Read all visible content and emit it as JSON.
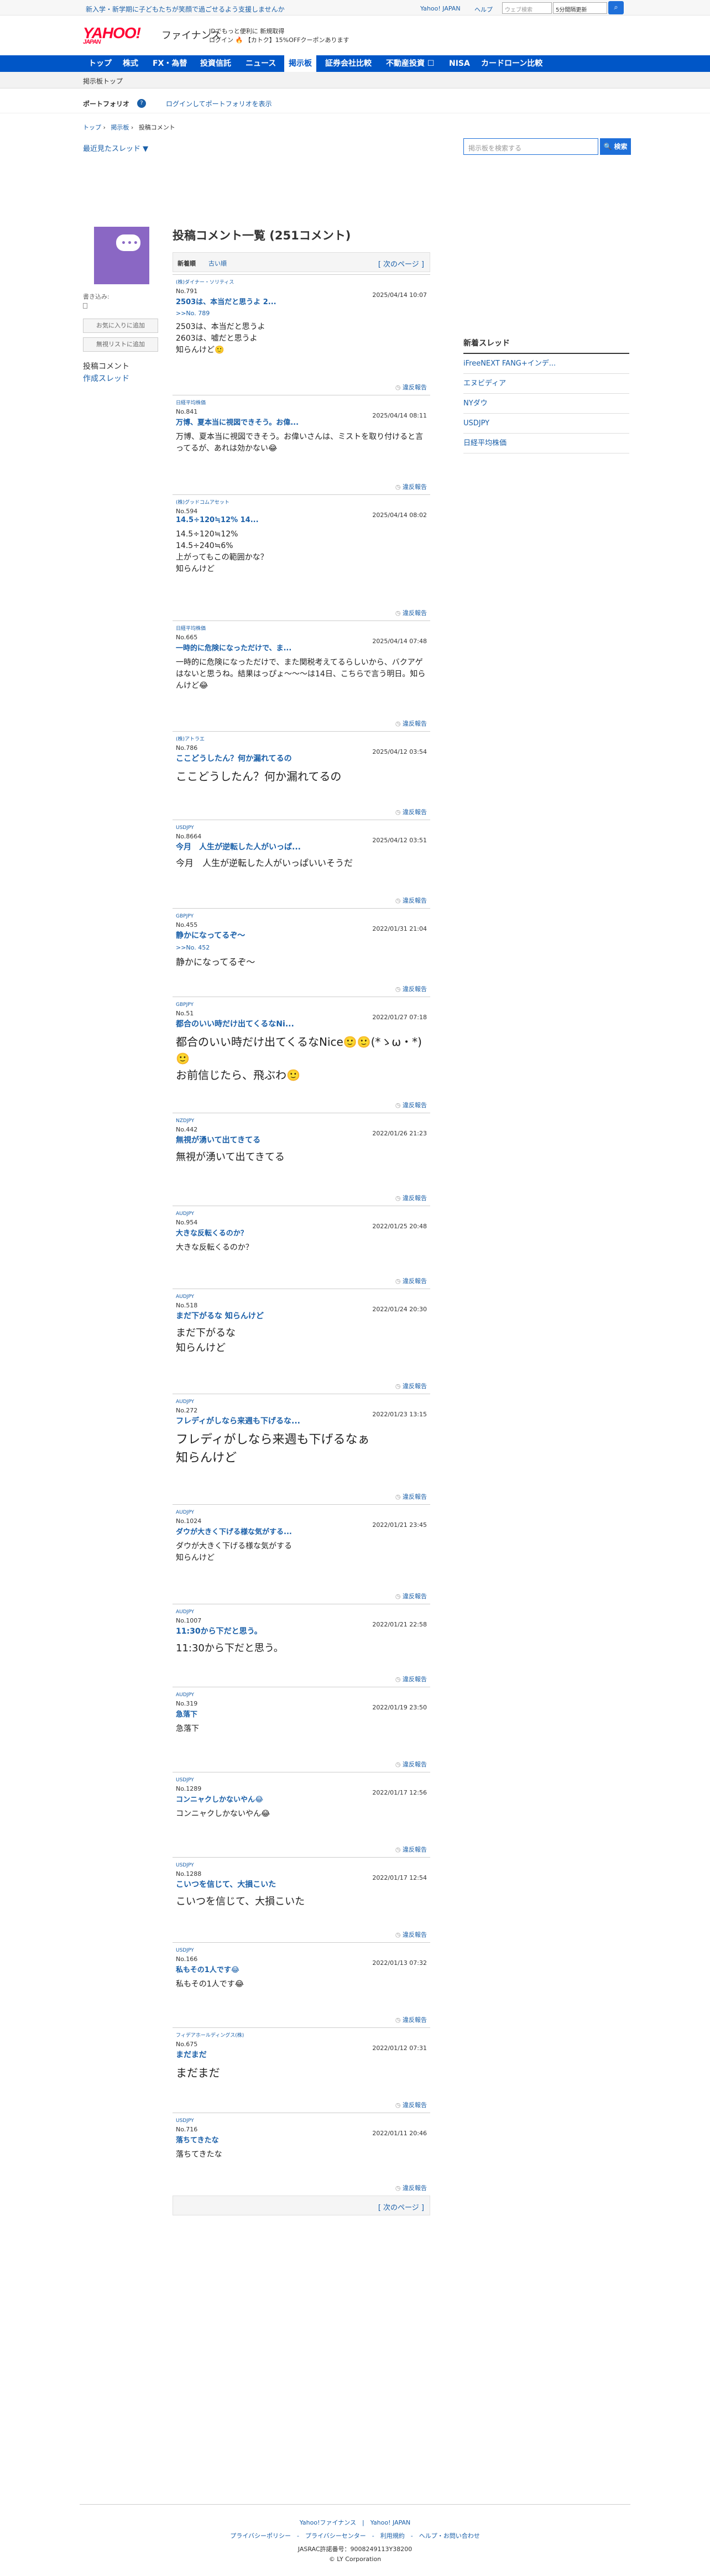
{
  "topbar": {
    "promo": "新入学・新学期に子どもたちが笑顔で過ごせるよう支援しませんか",
    "yahoo_japan": "Yahoo! JAPAN",
    "help": "ヘルプ",
    "web_search_placeholder": "ウェブ検索",
    "select_label": "5分間隔更新"
  },
  "brand": {
    "logo": "YAHOO!",
    "logo_sub": "JAPAN",
    "service": "ファイナンス",
    "line1": "IDでもっと便利に 新規取得",
    "line2": "ログイン 🔥 【カトク】15%OFFクーポンあります"
  },
  "nav": [
    "トップ",
    "株式",
    "FX・為替",
    "投資信託",
    "ニュース",
    "掲示板",
    "証券会社比較",
    "不動産投資 ☐",
    "NISA",
    "カードローン比較"
  ],
  "nav_active": "掲示板",
  "sub_nav": {
    "board_top": "掲示板トップ"
  },
  "portfolio": {
    "label": "ポートフォリオ",
    "help": "?",
    "login": "ログインしてポートフォリオを表示"
  },
  "breadcrumb": [
    "トップ",
    "掲示板",
    "投稿コメント"
  ],
  "recent_threads": "最近見たスレッド ▼",
  "board_search": {
    "placeholder": "掲示板を検索する",
    "button": "🔍 検索"
  },
  "sidebar": {
    "owner_label": "書き込み:",
    "favorite_button": "お気に入りに追加",
    "ignore_button": "無視リストに追加",
    "menu_posts": "投稿コメント",
    "menu_threads": "作成スレッド"
  },
  "main": {
    "title": "投稿コメント一覧 (251コメント)",
    "tab_new": "新着順",
    "tab_old": "古い順",
    "next": "[ 次のページ ]",
    "report_label": "違反報告"
  },
  "posts": [
    {
      "stock": "(株)ダイナー・ソリティス",
      "no": "No.791",
      "date": "2025/04/14 10:07",
      "title": "2503は、本当だと思うよ 2...",
      "reply": ">>No. 789",
      "body": "2503は、本当だと思うよ\n2603は、嘘だと思うよ\n知らんけど🙂",
      "size": "14px"
    },
    {
      "stock": "日経平均株価",
      "no": "No.841",
      "date": "2025/04/14 08:11",
      "title": "万博、夏本当に視図できそう。お偉...",
      "reply": "",
      "body": "万博、夏本当に視図できそう。お偉いさんは、ミストを取り付けると言ってるが、あれは効かない😂",
      "size": "14px"
    },
    {
      "stock": "(株)グッドコムアセット",
      "no": "No.594",
      "date": "2025/04/14 08:02",
      "title": "14.5÷120≒12% 14...",
      "reply": "",
      "body": "14.5÷120≒12%\n14.5÷240≒6%\n上がってもこの範囲かな？\n知らんけど",
      "size": "14px"
    },
    {
      "stock": "日経平均株価",
      "no": "No.665",
      "date": "2025/04/14 07:48",
      "title": "一時的に危険になっただけで、ま...",
      "reply": "",
      "body": "一時的に危険になっただけで、また関税考えてるらしいから、バクアゲはないと思うね。結果はっぴょ〜〜〜は14日、こちらで言う明日。知らんけど😂",
      "size": "14px"
    },
    {
      "stock": "(株)アトラエ",
      "no": "No.786",
      "date": "2025/04/12 03:54",
      "title": "ここどうしたん？何か漏れてるの",
      "reply": "",
      "body": "ここどうしたん？何か漏れてるの",
      "size": "20px"
    },
    {
      "stock": "USDJPY",
      "no": "No.8664",
      "date": "2025/04/12 03:51",
      "title": "今月　人生が逆転した人がいっぱ...",
      "reply": "",
      "body": "今月　人生が逆転した人がいっぱいいそうだ",
      "size": "16px"
    },
    {
      "stock": "GBPJPY",
      "no": "No.455",
      "date": "2022/01/31 21:04",
      "title": "静かになってるぞ〜",
      "reply": ">>No. 452",
      "body": "静かになってるぞ〜",
      "size": "16px"
    },
    {
      "stock": "GBPJPY",
      "no": "No.51",
      "date": "2022/01/27 07:18",
      "title": "都合のいい時だけ出てくるなNi...",
      "reply": "",
      "body": "都合のいい時だけ出てくるなNice🙂🙂(*ゝω・*)🙂\nお前信じたら、飛ぶわ🙂",
      "size": "20px"
    },
    {
      "stock": "NZDJPY",
      "no": "No.442",
      "date": "2022/01/26 21:23",
      "title": "無視が湧いて出てきてる",
      "reply": "",
      "body": "無視が湧いて出てきてる",
      "size": "18px"
    },
    {
      "stock": "AUDJPY",
      "no": "No.954",
      "date": "2022/01/25 20:48",
      "title": "大きな反転くるのか？",
      "reply": "",
      "body": "大きな反転くるのか？",
      "size": "14px"
    },
    {
      "stock": "AUDJPY",
      "no": "No.518",
      "date": "2022/01/24 20:30",
      "title": "まだ下がるな 知らんけど",
      "reply": "",
      "body": "まだ下がるな\n知らんけど",
      "size": "18px"
    },
    {
      "stock": "AUDJPY",
      "no": "No.272",
      "date": "2022/01/23 13:15",
      "title": "フレディがしなら来週も下げるな...",
      "reply": "",
      "body": "フレディがしなら来週も下げるなぁ\n知らんけど",
      "size": "22px"
    },
    {
      "stock": "AUDJPY",
      "no": "No.1024",
      "date": "2022/01/21 23:45",
      "title": "ダウが大きく下げる様な気がする...",
      "reply": "",
      "body": "ダウが大きく下げる様な気がする\n知らんけど",
      "size": "14px"
    },
    {
      "stock": "AUDJPY",
      "no": "No.1007",
      "date": "2022/01/21 22:58",
      "title": "11:30から下だと思う。",
      "reply": "",
      "body": "11:30から下だと思う。",
      "size": "18px"
    },
    {
      "stock": "AUDJPY",
      "no": "No.319",
      "date": "2022/01/19 23:50",
      "title": "急落下",
      "reply": "",
      "body": "急落下",
      "size": "14px"
    },
    {
      "stock": "USDJPY",
      "no": "No.1289",
      "date": "2022/01/17 12:56",
      "title": "コンニャクしかないやん😂",
      "reply": "",
      "body": "コンニャクしかないやん😂",
      "size": "14px"
    },
    {
      "stock": "USDJPY",
      "no": "No.1288",
      "date": "2022/01/17 12:54",
      "title": "こいつを信じて、大損こいた",
      "reply": "",
      "body": "こいつを信じて、大損こいた",
      "size": "18px"
    },
    {
      "stock": "USDJPY",
      "no": "No.166",
      "date": "2022/01/13 07:32",
      "title": "私もその1人です😂",
      "reply": "",
      "body": "私もその1人です😂",
      "size": "14px"
    },
    {
      "stock": "フィデアホールディングス(株)",
      "no": "No.675",
      "date": "2022/01/12 07:31",
      "title": "まだまだ",
      "reply": "",
      "body": "まだまだ",
      "size": "20px"
    },
    {
      "stock": "USDJPY",
      "no": "No.716",
      "date": "2022/01/11 20:46",
      "title": "落ちてきたな",
      "reply": "",
      "body": "落ちてきたな",
      "size": "14px"
    }
  ],
  "pager_next": "[ 次のページ ]",
  "new_threads": {
    "heading": "新着スレッド",
    "items": [
      "iFreeNEXT FANG+インデ...",
      "エヌビディア",
      "NYダウ",
      "USDJPY",
      "日経平均株価"
    ]
  },
  "footer": {
    "links1": "Yahoo!ファイナンス　|　Yahoo! JAPAN",
    "links2": "プライバシーポリシー　-　プライバシーセンター　-　利用規約　-　ヘルプ・お問い合わせ",
    "jasrac": "JASRAC許諾番号：9008249113Y38200",
    "copyright": "© LY Corporation"
  },
  "colors": {
    "nav_bg": "#0056c7",
    "link": "#1a5fa8",
    "logo": "#ff0033",
    "avatar": "#8a67c4"
  }
}
